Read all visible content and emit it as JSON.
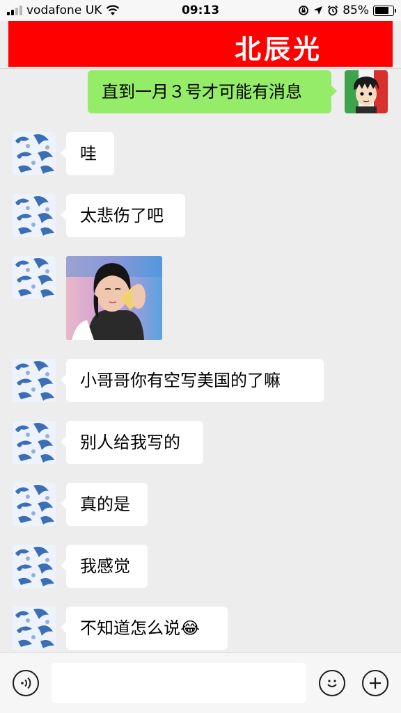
{
  "status_bar": {
    "carrier": "vodafone UK",
    "time": "09:13",
    "battery_percent": "85%",
    "battery_level": 0.85
  },
  "header": {
    "title": "北辰光"
  },
  "messages": [
    {
      "side": "right",
      "text": "直到一月３号才可能有消息"
    },
    {
      "side": "left",
      "text": "哇"
    },
    {
      "side": "left",
      "text": "太悲伤了吧"
    },
    {
      "side": "left",
      "type": "sticker"
    },
    {
      "side": "left",
      "text": "小哥哥你有空写美国的了嘛"
    },
    {
      "side": "left",
      "text": "别人给我写的"
    },
    {
      "side": "left",
      "text": "真的是"
    },
    {
      "side": "left",
      "text": "我感觉"
    },
    {
      "side": "left",
      "text": "不知道怎么说",
      "emoji": "😂"
    }
  ],
  "input_bar": {
    "placeholder": ""
  },
  "colors": {
    "banner": "#ff0000",
    "outgoing_bubble": "#95ec69",
    "incoming_bubble": "#ffffff",
    "background": "#ededed"
  },
  "icons": [
    "signal-icon",
    "wifi-icon",
    "rotation-lock-icon",
    "location-icon",
    "alarm-icon",
    "battery-icon",
    "voice-icon",
    "emoji-icon",
    "plus-icon"
  ]
}
